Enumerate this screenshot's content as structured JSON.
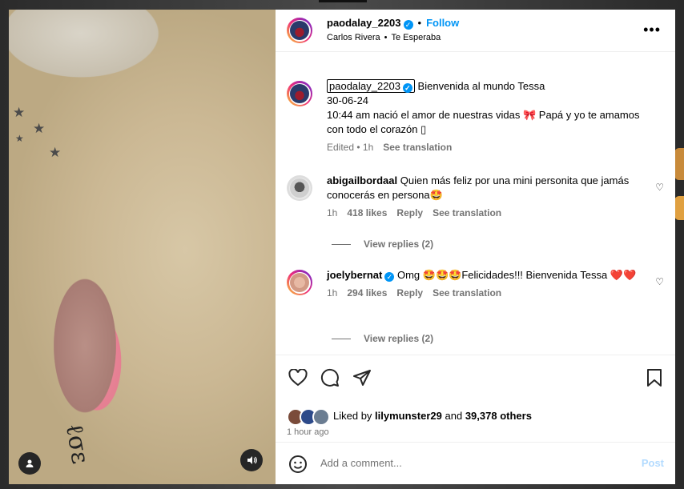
{
  "post": {
    "username": "paodalay_2203",
    "follow_label": "Follow",
    "audio_artist": "Carlos Rivera",
    "audio_song": "Te Esperaba",
    "more_label": "•••"
  },
  "caption": {
    "username": "paodalay_2203",
    "line1": "Bienvenida al mundo Tessa",
    "line2": "30-06-24",
    "line3": "10:44 am nació el amor de nuestras vidas 🎀 Papá y yo te amamos con todo el corazón ▯",
    "edited": "Edited • 1h",
    "see_translation": "See translation"
  },
  "comments": [
    {
      "username": "abigailbordaal",
      "text": "Quien más feliz por una mini personita que jamás conocerás en persona🤩",
      "time": "1h",
      "likes": "418 likes",
      "reply": "Reply",
      "see_translation": "See translation",
      "view_replies": "View replies (2)"
    },
    {
      "username": "joelybernat",
      "text": "Omg 🤩🤩🤩Felicidades!!! Bienvenida Tessa ❤️❤️",
      "time": "1h",
      "likes": "294 likes",
      "reply": "Reply",
      "see_translation": "See translation",
      "view_replies": "View replies (2)"
    }
  ],
  "liked_by": {
    "prefix": "Liked by",
    "user": "lilymunster29",
    "middle": "and",
    "others": "39,378 others"
  },
  "timestamp": "1 hour ago",
  "add_comment": {
    "placeholder": "Add a comment...",
    "post_label": "Post"
  },
  "icons": {
    "verified": "✓",
    "heart_small": "♡",
    "emoji": "☺",
    "user": "●",
    "speaker": "◀)"
  },
  "colors": {
    "link": "#0095f6",
    "muted": "#737373",
    "post_disabled": "#b3dbff"
  }
}
